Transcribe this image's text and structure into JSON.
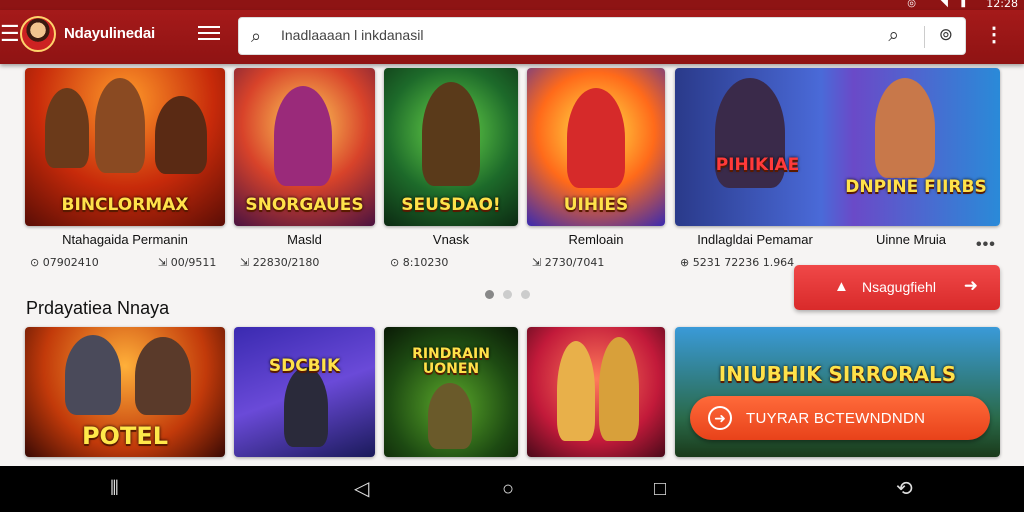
{
  "status": {
    "time": "12:28"
  },
  "app": {
    "name": "Ndayulinedai",
    "colors": {
      "primary": "#9b1616",
      "accent": "#e8421a"
    }
  },
  "search": {
    "placeholder": "Inadlaaaan l inkdanasil"
  },
  "top_games": [
    {
      "title_art": "BINCLORMAX",
      "name": "Ntahagaida Permanin",
      "stats": "⊙ 07902410"
    },
    {
      "title_art": "SNORGAUES",
      "name": "Masld",
      "stats": "⇲ 00/9511"
    },
    {
      "title_art": "SEUSDAO!",
      "name": "Vnask",
      "stats": "⇲ 22830/2180"
    },
    {
      "title_art": "UIHIES",
      "name": "Remloain",
      "stats": "⊙ 8:10230"
    },
    {
      "title_art": "PIHIKIAE",
      "name": "Indlagldai Pemamar",
      "stats": "⇲ 2730/7041"
    },
    {
      "title_art": "DNPINE FIIRBS",
      "name": "Uinne Mruia",
      "stats": "⊕ 5231 72236 1.964"
    }
  ],
  "more_label": "•••",
  "red_button": {
    "label": "Nsagugfiehl"
  },
  "section": {
    "title": "Prdayatiea Nnaya"
  },
  "bottom_games": [
    {
      "title_art": "POTEL"
    },
    {
      "title_art": "SDCBIK"
    },
    {
      "title_art": "RINDRAIN UONEN"
    },
    {
      "title_art": ""
    },
    {
      "title_art": "INIUBHIK  SIRRORALS"
    }
  ],
  "promo_button": {
    "label": "TUYRAR BCTEWNDNDN"
  }
}
